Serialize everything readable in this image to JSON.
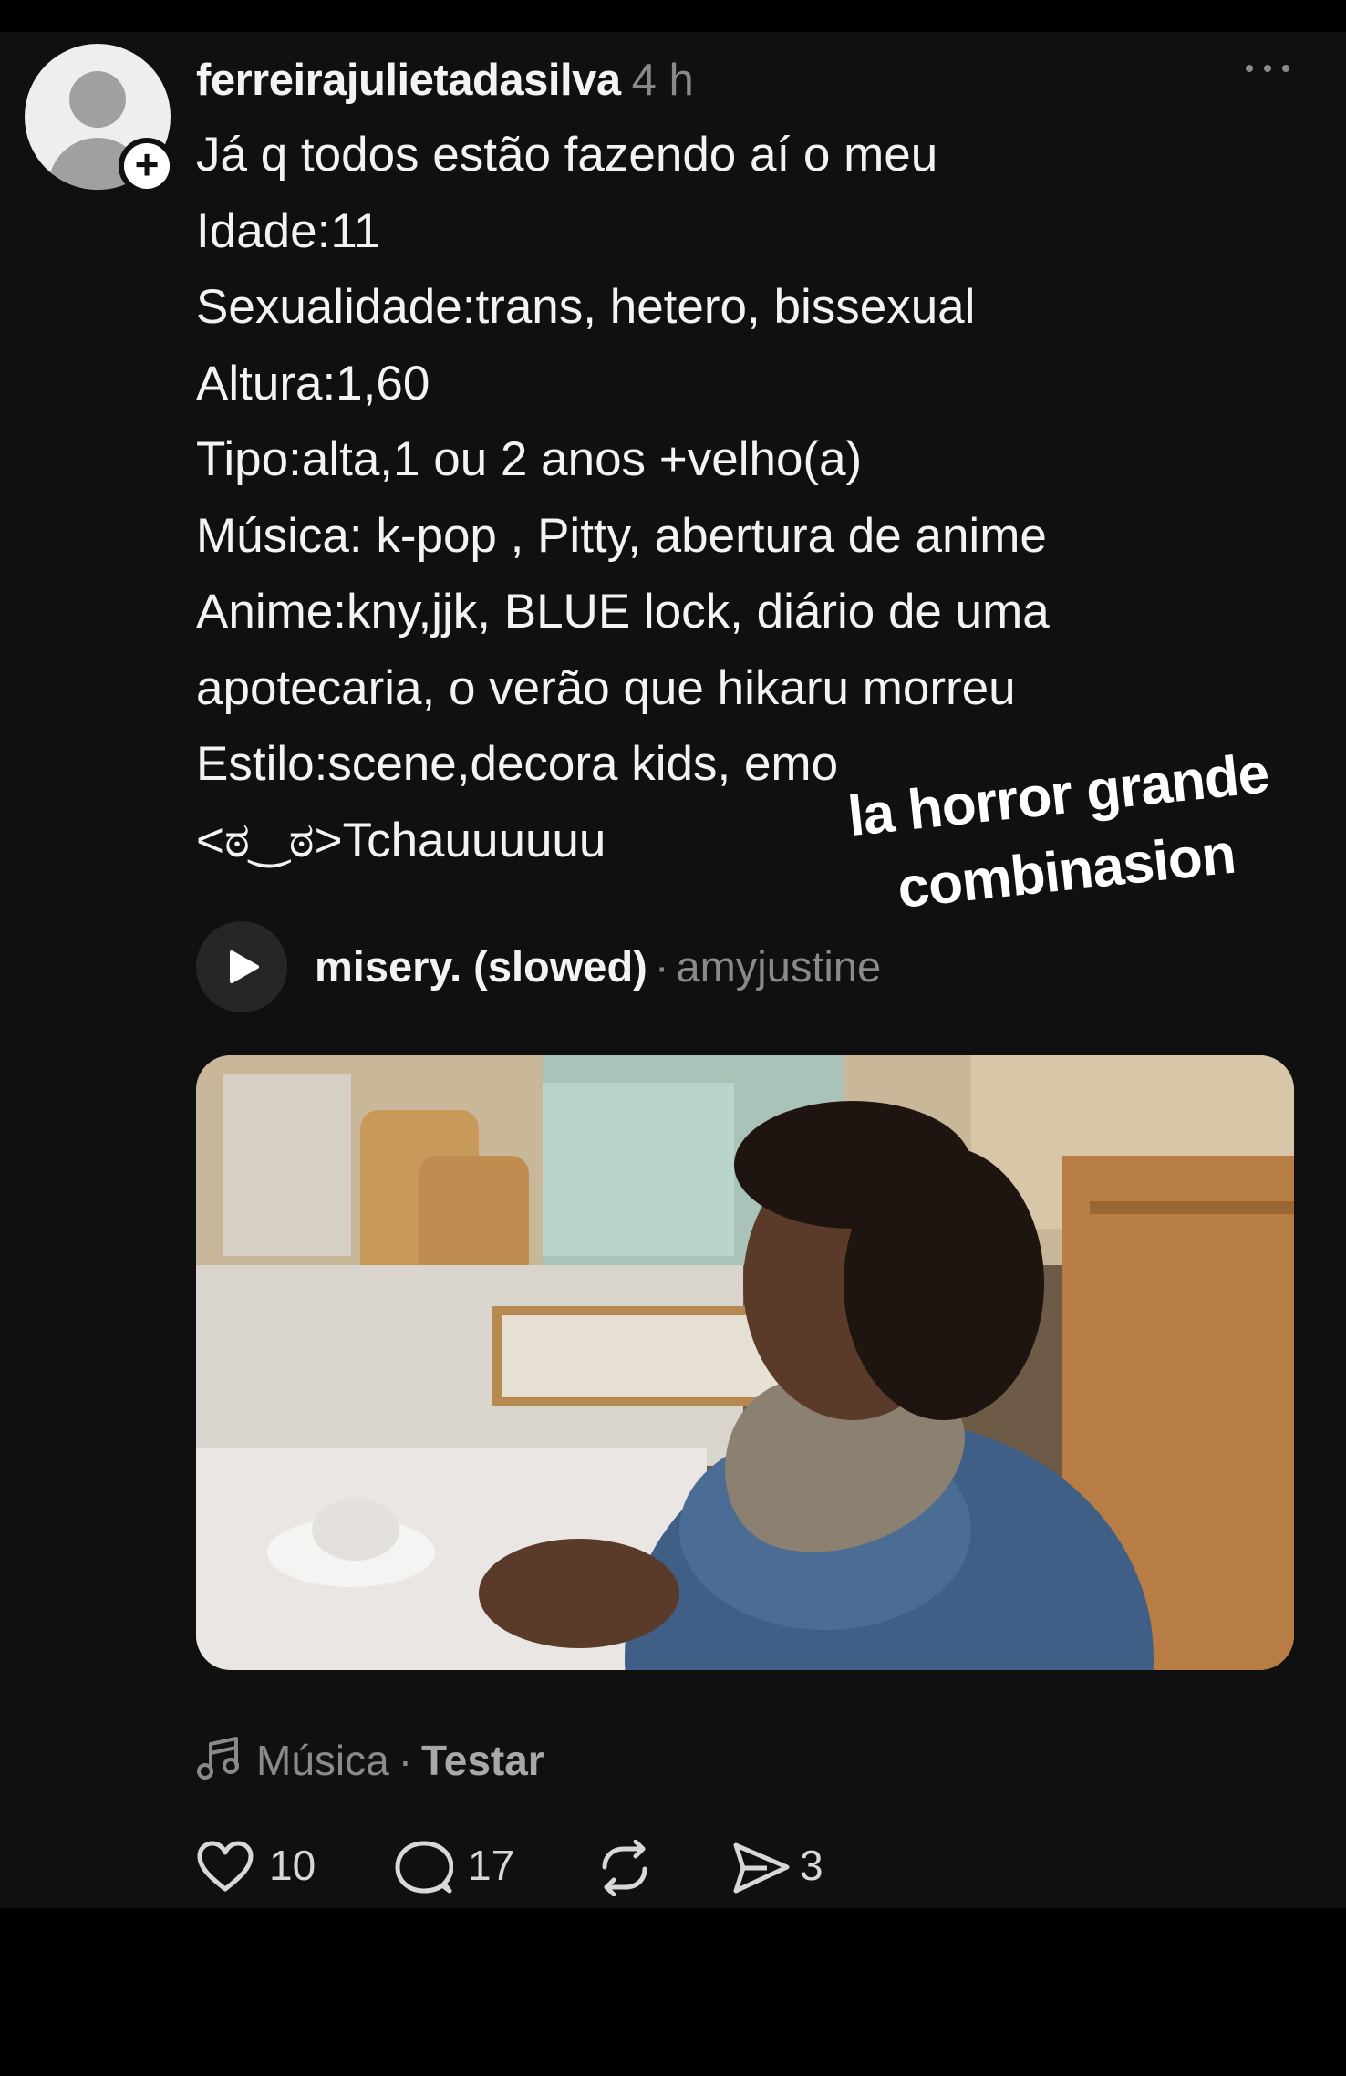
{
  "post": {
    "author": {
      "username": "ferreirajulietadasilva",
      "timestamp": "4 h",
      "avatar_icon": "default-avatar-icon",
      "follow_icon": "plus-icon"
    },
    "more_icon": "more-options-icon",
    "text_lines": [
      "Já q todos estão fazendo aí o meu",
      "Idade:11",
      "Sexualidade:trans, hetero, bissexual",
      "Altura:1,60",
      "Tipo:alta,1 ou 2 anos +velho(a)",
      "Música: k-pop , Pitty, abertura de anime",
      "Anime:kny,jjk, BLUE lock, diário de uma",
      "apotecaria, o verão que hikaru morreu",
      "Estilo:scene,decora kids, emo",
      "<ಠ‿ಠ>Tchauuuuuu"
    ],
    "overlay_caption": {
      "line1": "la horror grande",
      "line2": "combinasion"
    },
    "music_attachment": {
      "title": "misery. (slowed)",
      "separator": "·",
      "artist": "amyjustine",
      "play_icon": "play-icon"
    },
    "photo": {
      "icon": "post-photo"
    },
    "music_credit": {
      "icon": "music-note-icon",
      "label": "Música",
      "separator": "·",
      "action": "Testar"
    },
    "actions": {
      "likes": "10",
      "comments": "17",
      "shares": "3",
      "like_icon": "heart-icon",
      "comment_icon": "comment-icon",
      "repost_icon": "repost-icon",
      "share_icon": "send-icon"
    }
  },
  "colors": {
    "background": "#101010",
    "text_primary": "#f3f3f3",
    "text_secondary": "#8a8a8a"
  }
}
